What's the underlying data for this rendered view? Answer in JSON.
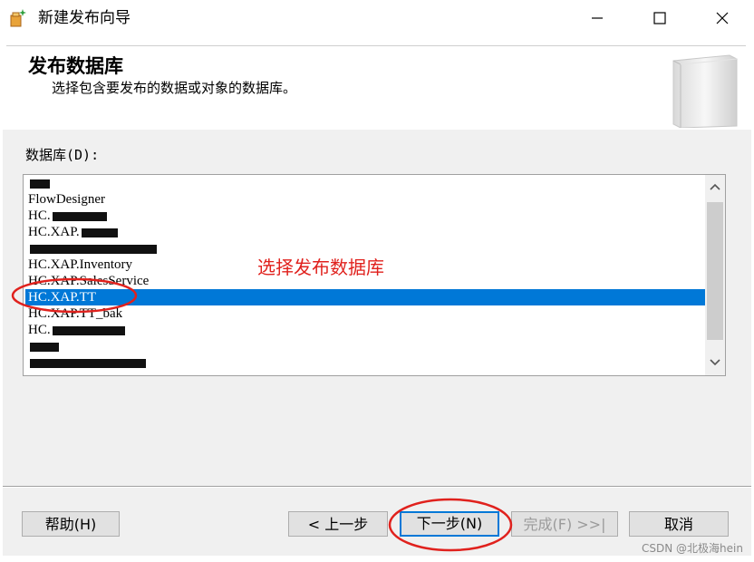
{
  "window": {
    "title": "新建发布向导",
    "icons": {
      "app": "wizard-icon",
      "minimize": "minimize-icon",
      "maximize": "maximize-icon",
      "close": "close-icon"
    }
  },
  "header": {
    "title": "发布数据库",
    "subtitle": "选择包含要发布的数据或对象的数据库。",
    "art_icon": "database-icon"
  },
  "database_list": {
    "label": "数据库(D):",
    "items": [
      {
        "text": "",
        "selected": false
      },
      {
        "text": "FlowDesigner",
        "selected": false
      },
      {
        "text": "HC.",
        "selected": false
      },
      {
        "text": "HC.XAP.",
        "selected": false
      },
      {
        "text": "",
        "selected": false
      },
      {
        "text": "HC.XAP.Inventory",
        "selected": false
      },
      {
        "text": "HC.XAP.SalesService",
        "selected": false
      },
      {
        "text": "HC.XAP.TT",
        "selected": true
      },
      {
        "text": "HC.XAP.TT_bak",
        "selected": false
      },
      {
        "text": "HC.",
        "selected": false
      },
      {
        "text": "",
        "selected": false
      },
      {
        "text": "",
        "selected": false
      }
    ]
  },
  "annotation": {
    "text": "选择发布数据库",
    "color": "#e0211d"
  },
  "buttons": {
    "help": "帮助(H)",
    "back": "< 上一步",
    "next": "下一步(N)",
    "finish": "完成(F) >>|",
    "cancel": "取消"
  },
  "watermark": "CSDN @北极海hein",
  "colors": {
    "selection": "#0078d7",
    "annotation": "#e0211d"
  }
}
